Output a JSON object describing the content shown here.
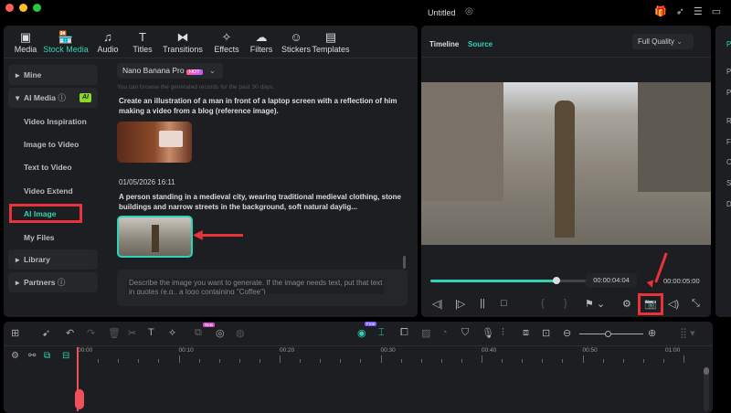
{
  "window": {
    "title": "Untitled"
  },
  "tabs": [
    {
      "label": "Media",
      "icon": "media-icon"
    },
    {
      "label": "Stock Media",
      "icon": "store-icon"
    },
    {
      "label": "Audio",
      "icon": "music-icon"
    },
    {
      "label": "Titles",
      "icon": "title-icon"
    },
    {
      "label": "Transitions",
      "icon": "transition-icon"
    },
    {
      "label": "Effects",
      "icon": "effects-icon"
    },
    {
      "label": "Filters",
      "icon": "filters-icon"
    },
    {
      "label": "Stickers",
      "icon": "sticker-icon"
    },
    {
      "label": "Templates",
      "icon": "template-icon"
    }
  ],
  "sidebar": {
    "mine": "Mine",
    "ai_media": "AI Media",
    "ai_badge": "AI",
    "items": [
      "Video Inspiration",
      "Image to Video",
      "Text to Video",
      "Video Extend",
      "AI Image",
      "My Files"
    ],
    "library": "Library",
    "partners": "Partners"
  },
  "content": {
    "model": "Nano Banana Pro",
    "hot_badge": "HOT",
    "notice": "You can browse the generated records for the past 30 days.",
    "record1_prompt": "Create an illustration of a man in front of a laptop screen with a reflection of him making a video from a blog (reference image).",
    "record2_date": "01/05/2026 16:11",
    "record2_prompt": "A person standing in a medieval city, wearing traditional medieval clothing, stone buildings and narrow streets in the background, soft natural daylig...",
    "input_placeholder": "Describe the image you want to generate. If the image needs text, put that text in quotes (e.g., a logo containing \"Coffee\")"
  },
  "preview": {
    "tab_timeline": "Timeline",
    "tab_source": "Source",
    "quality": "Full Quality",
    "current_time": "00:00:04:04",
    "total_time": "00:00:05:00",
    "progress": 0.81
  },
  "right_panel": {
    "labels": [
      "P",
      "P",
      "R",
      "F",
      "C",
      "S",
      "D"
    ]
  },
  "timeline": {
    "new_badge": "New",
    "free_badge": "Free",
    "ticks": [
      "00:00",
      "00:10",
      "00:20",
      "00:30",
      "00:40",
      "00:50",
      "01:00"
    ]
  },
  "colors": {
    "accent": "#2ed3b7",
    "highlight": "#e8323c"
  }
}
